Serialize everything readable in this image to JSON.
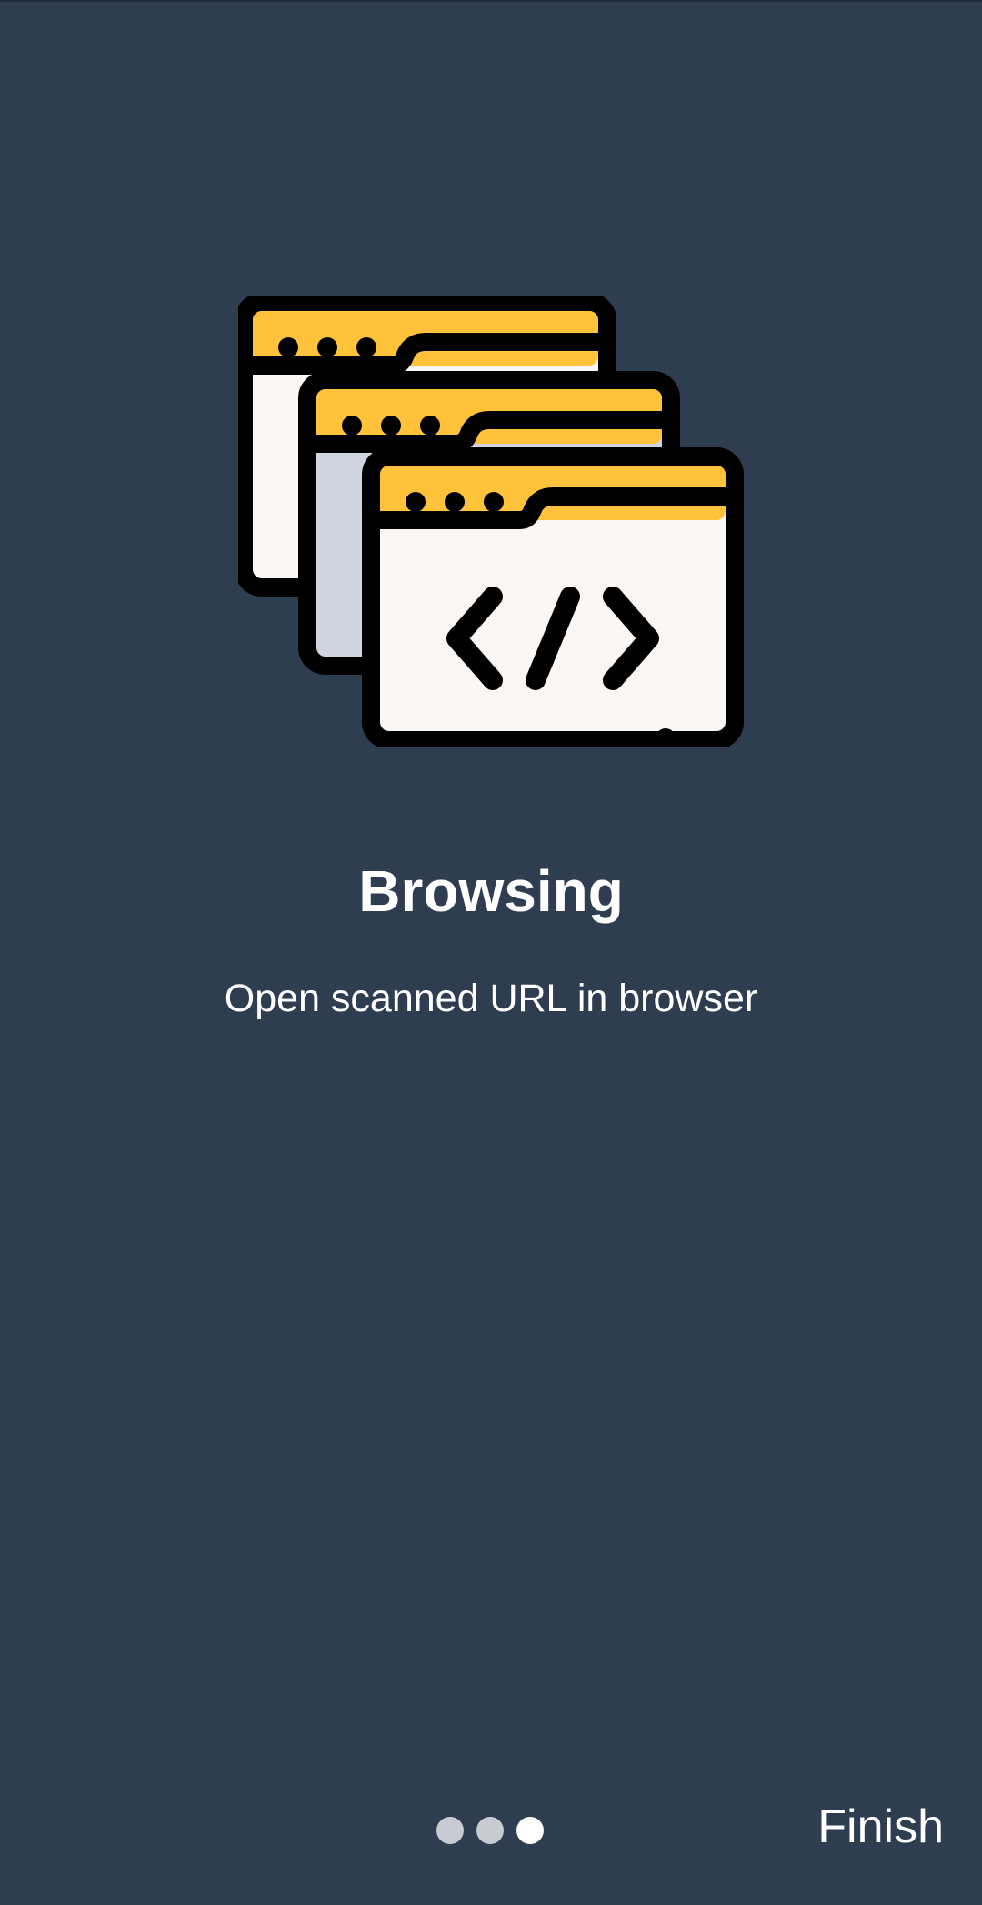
{
  "onboarding": {
    "title": "Browsing",
    "subtitle": "Open scanned URL in browser",
    "illustration_icon": "browser-windows-code-icon",
    "pager": {
      "total_pages": 3,
      "current_page": 3
    },
    "finish_label": "Finish"
  },
  "colors": {
    "background": "#2e3d50",
    "accent_yellow": "#ffc23a",
    "window_body_light": "#fbf7f5",
    "window_body_gray": "#d0d5e0",
    "outline": "#000000",
    "text": "#ffffff",
    "dot_inactive": "#c8ccd2",
    "dot_active": "#ffffff"
  }
}
